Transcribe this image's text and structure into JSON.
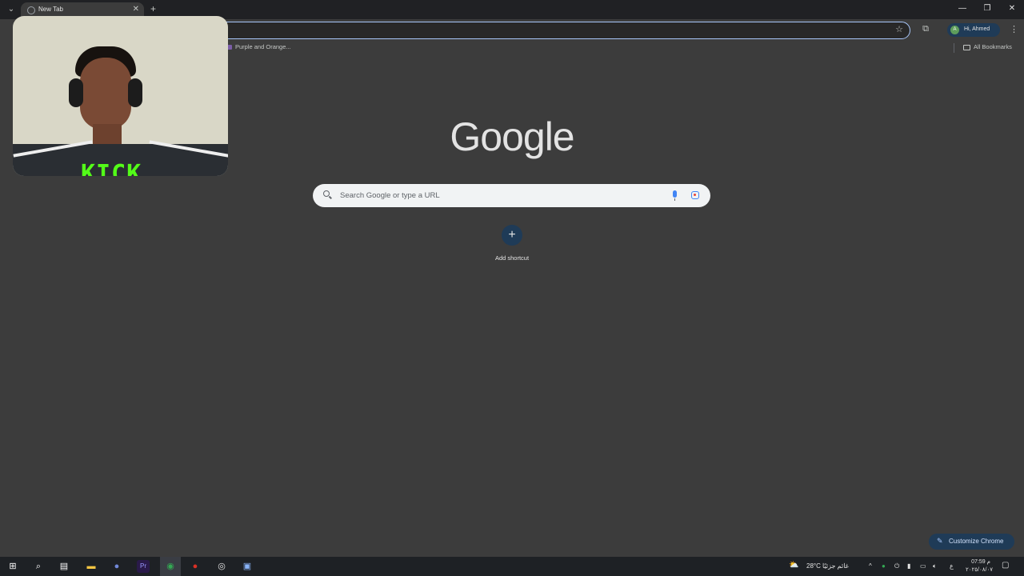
{
  "browser": {
    "tab": {
      "title": "New Tab"
    },
    "profile": {
      "initial": "A",
      "greeting": "Hi, Ahmed"
    },
    "bookmarks": {
      "item": "Purple and Orange...",
      "all_label": "All Bookmarks"
    },
    "accent": "#a8c7fa"
  },
  "webcam": {
    "overlay_text": "KICK",
    "overlay_color": "#53fc18"
  },
  "ntp": {
    "logo": "Google",
    "search_placeholder": "Search Google or type a URL",
    "add_shortcut_label": "Add shortcut",
    "customize_label": "Customize Chrome"
  },
  "taskbar": {
    "weather_temp": "28°C",
    "weather_text": "غائم جزئيًا",
    "clock_time": "07:59 م",
    "clock_date": "٢٠٢٥/٠٨/٠٧",
    "lang": "ع"
  }
}
